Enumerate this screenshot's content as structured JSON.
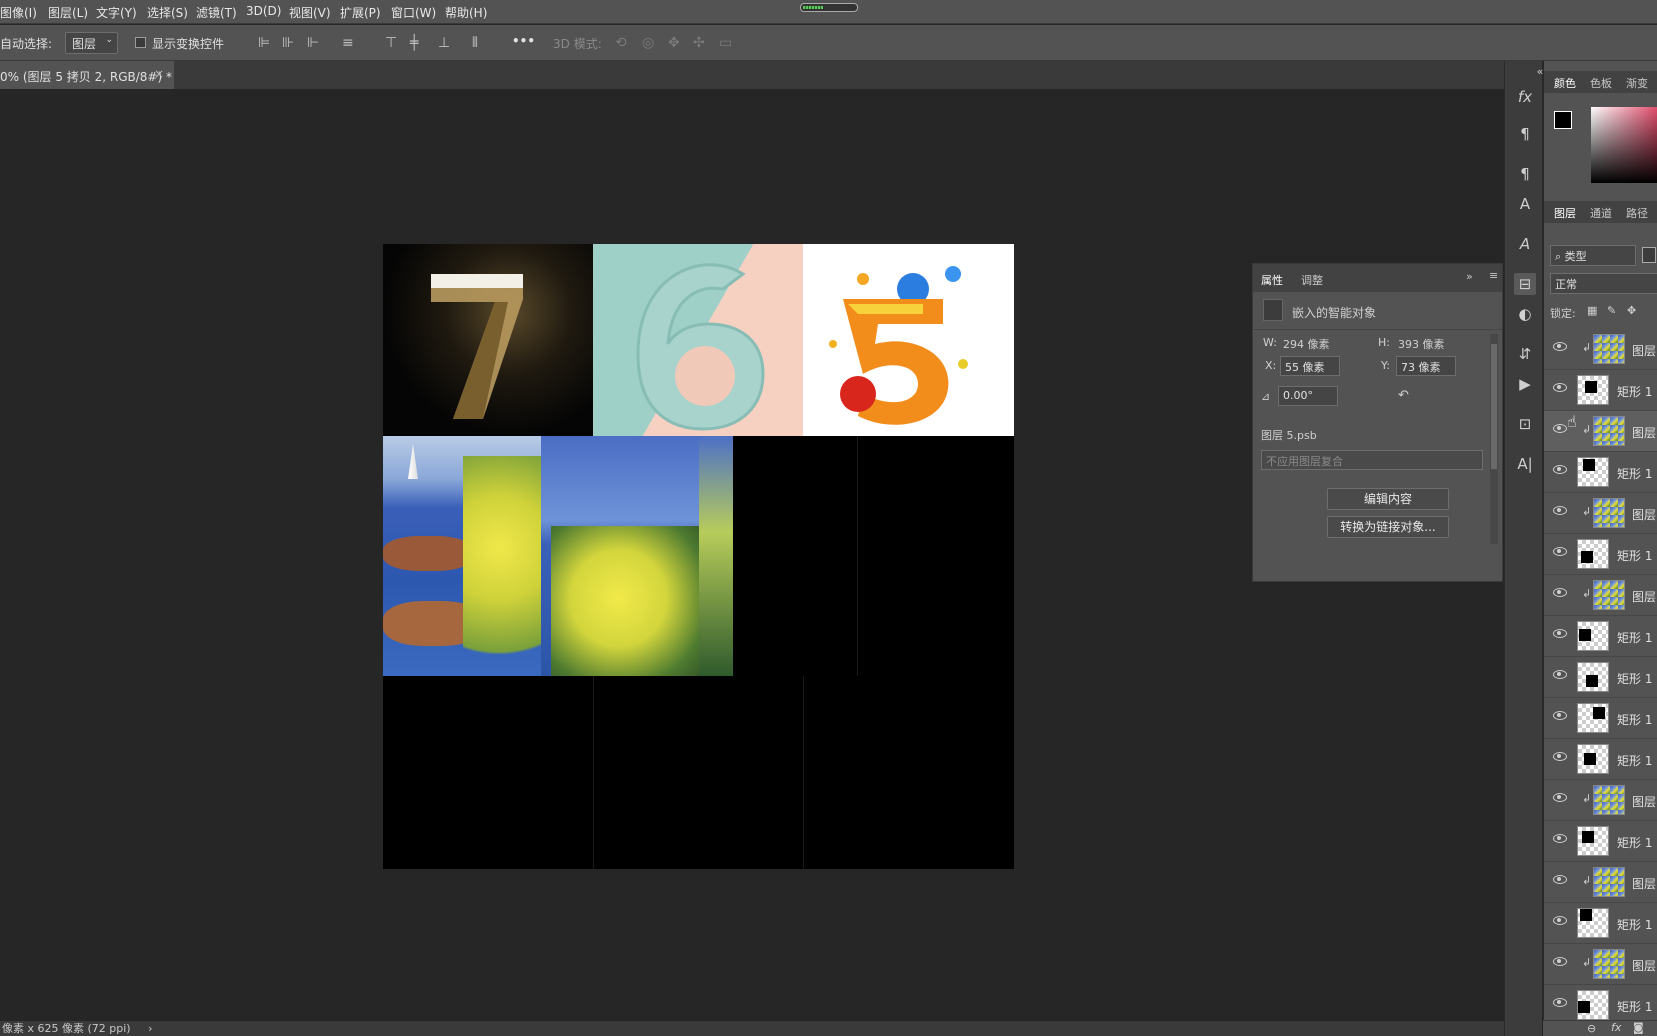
{
  "menu": [
    "图像(I)",
    "图层(L)",
    "文字(Y)",
    "选择(S)",
    "滤镜(T)",
    "3D(D)",
    "视图(V)",
    "扩展(P)",
    "窗口(W)",
    "帮助(H)"
  ],
  "options": {
    "auto_select_label": "自动选择:",
    "auto_select_value": "图层",
    "show_transform_label": "显示变换控件",
    "more": "•••",
    "mode_3d_label": "3D 模式:"
  },
  "doc_tab": {
    "title": "0% (图层 5 拷贝 2, RGB/8#) *",
    "close": "×"
  },
  "canvas": {
    "digits": [
      "7",
      "6",
      "5"
    ],
    "colors": {
      "bg": "#000000",
      "sea": "#3a5fb8",
      "yellow": "#e6df3a",
      "peach": "#f6d1c2",
      "mint": "#9fd0c8"
    }
  },
  "right_tabs": {
    "top": [
      "颜色",
      "色板",
      "渐变"
    ],
    "layers_tabs": [
      "图层",
      "通道",
      "路径"
    ]
  },
  "layers_panel": {
    "filter": "类型",
    "blend": "正常",
    "lock_label": "锁定:",
    "layers": [
      {
        "name": "图层",
        "clip": true,
        "kind": "photo"
      },
      {
        "name": "矩形 1",
        "clip": false,
        "kind": "rect"
      },
      {
        "name": "图层",
        "clip": true,
        "kind": "photo",
        "selected": true
      },
      {
        "name": "矩形 1",
        "clip": false,
        "kind": "rect"
      },
      {
        "name": "图层",
        "clip": true,
        "kind": "photo"
      },
      {
        "name": "矩形 1",
        "clip": false,
        "kind": "rect"
      },
      {
        "name": "图层",
        "clip": true,
        "kind": "photo"
      },
      {
        "name": "矩形 1",
        "clip": false,
        "kind": "rect"
      },
      {
        "name": "矩形 1",
        "clip": false,
        "kind": "rect"
      },
      {
        "name": "矩形 1",
        "clip": false,
        "kind": "rect"
      },
      {
        "name": "矩形 1",
        "clip": false,
        "kind": "rect"
      },
      {
        "name": "图层",
        "clip": true,
        "kind": "photo"
      },
      {
        "name": "矩形 1",
        "clip": false,
        "kind": "rect"
      },
      {
        "name": "图层",
        "clip": true,
        "kind": "photo"
      },
      {
        "name": "矩形 1",
        "clip": false,
        "kind": "rect"
      },
      {
        "name": "图层",
        "clip": true,
        "kind": "photo"
      },
      {
        "name": "矩形 1",
        "clip": false,
        "kind": "rect"
      }
    ]
  },
  "properties": {
    "tabs": [
      "属性",
      "调整"
    ],
    "object_type": "嵌入的智能对象",
    "w_label": "W:",
    "w_value": "294 像素",
    "h_label": "H:",
    "h_value": "393 像素",
    "x_label": "X:",
    "x_value": "55 像素",
    "y_label": "Y:",
    "y_value": "73 像素",
    "angle_value": "0.00°",
    "file_label": "图层 5.psb",
    "comp_placeholder": "不应用图层复合",
    "edit_button": "编辑内容",
    "convert_button": "转换为链接对象..."
  },
  "status": {
    "text": "像素 x 625 像素 (72 ppi)",
    "arrow": "›"
  }
}
